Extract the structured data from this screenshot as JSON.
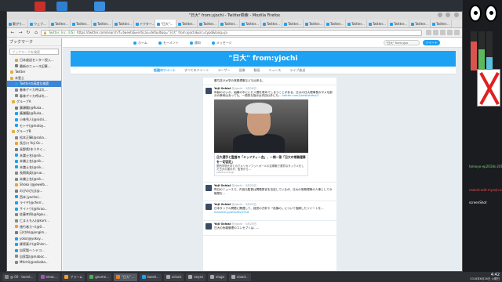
{
  "window_title": "\"日大\" from:yjochi - Twitter検索 - Mozilla Firefox",
  "tabs": [
    {
      "label": "繋がり..."
    },
    {
      "label": "ウェブ..."
    },
    {
      "label": "Twitter..."
    },
    {
      "label": "Twitter..."
    },
    {
      "label": "Twitter..."
    },
    {
      "label": "Twitter..."
    },
    {
      "label": "ドクター..."
    },
    {
      "label": "\"日大\"..."
    },
    {
      "label": "Twitter..."
    },
    {
      "label": "Twitter..."
    },
    {
      "label": "Twitter..."
    },
    {
      "label": "Twitter..."
    },
    {
      "label": "Twitter..."
    },
    {
      "label": "Twitter..."
    },
    {
      "label": "Twitter..."
    },
    {
      "label": "Twitter..."
    },
    {
      "label": "Twitter..."
    },
    {
      "label": "Twitter..."
    },
    {
      "label": "Twitter..."
    },
    {
      "label": "Twitter..."
    },
    {
      "label": "Twitter..."
    }
  ],
  "url": {
    "site": "Twitter, Inc. (US)",
    "path": "https://twitter.com/search?f=tweets&vertical=default&q=\"日大\" from:yjochi&src=typd&lang=ja"
  },
  "sidebar": {
    "title": "ブックマーク",
    "search_placeholder": "ブックマークを検索",
    "items": [
      {
        "label": "日本放送センター投入..."
      },
      {
        "label": "最新のニュース記事..."
      },
      {
        "label": "Twitter"
      },
      {
        "label": "未登士"
      },
      {
        "label": "Twitterの高度な検索"
      },
      {
        "label": "春林ゲイカ呼ばれ..."
      },
      {
        "label": "春林ゲイカ呼ばれ..."
      },
      {
        "label": "グループA"
      },
      {
        "label": "廣瀬龍(@Ruka..."
      },
      {
        "label": "廣瀬龍(@Ruka..."
      },
      {
        "label": "小林秀人(@nishi..."
      },
      {
        "label": "モトヤ(@motoy..."
      },
      {
        "label": "グループB"
      },
      {
        "label": "松本正輝(@saka..."
      },
      {
        "label": "長谷川 Yoji Oc..."
      },
      {
        "label": "長野県(ゆうやく..."
      },
      {
        "label": "未識士名(@nik..."
      },
      {
        "label": "未識士名(@nik..."
      },
      {
        "label": "未識士名(@nik..."
      },
      {
        "label": "長期高英(@ruo..."
      },
      {
        "label": "未識士名(@nik..."
      },
      {
        "label": "Shoko (@jewelb..."
      },
      {
        "label": "のびのび山(@..."
      },
      {
        "label": "西本 Jyocho(..."
      },
      {
        "label": "ライヤ(@cherr..."
      },
      {
        "label": "サイトウ(@hirao..."
      },
      {
        "label": "佐藤幸四(@Agou..."
      },
      {
        "label": "仁まえもん(@kum..."
      },
      {
        "label": "旅行者カイ(@0..."
      },
      {
        "label": "日付市(@jongim..."
      },
      {
        "label": "yoko(@yokoy..."
      },
      {
        "label": "柳原真介(@Shinn..."
      },
      {
        "label": "自家製ヘンテコ..."
      },
      {
        "label": "自家製(@maboc..."
      },
      {
        "label": "Mtichi(@seikoba..."
      }
    ]
  },
  "twitter_nav": {
    "home": "ホーム",
    "moments": "モーメント",
    "notifications": "通知",
    "messages": "メッセージ",
    "search_value": "\"日大\" from:yjoc",
    "tweet_button": "ツイート"
  },
  "banner_title": "\"日大\" from:yjochi",
  "subnav": [
    "話題のツイート",
    "すべてのツイート",
    "ユーザー",
    "画像",
    "動画",
    "ニュース",
    "ライブ放送"
  ],
  "tweets": [
    {
      "header": "",
      "handle": "",
      "text": "勝ち抜け大学の常務理事なども出来る。"
    },
    {
      "header": "Yoji Ochiai",
      "handle": "@yjochi · 5月26日",
      "text": "年齢のせいか、組織の中にいた人間を褒めてしまうことがある。日大の日大理事長のダメな部分の事例はあっても、一般的な指示は内田以外にも…",
      "link": "twitter.com/i/web/status/1",
      "has_photo": true,
      "card_title": "日大選手と監督の「ミッドティー会」、一問一答「日大の常務理事を一切否定」",
      "card_desc": "関西学院大学とのアメリカンフットボールの定期戦で悪質なタックルをした日大の選手が、監督から…",
      "card_url": "yomiuri.co.jp"
    },
    {
      "header": "Yoji Ochiai",
      "handle": "@yjochi · 5月25日",
      "text": "昨日のニュースで、内田元監督は問題発言を否定しているが、日大の常務理事の人事としての権限を…",
      "link": ""
    },
    {
      "header": "Yoji Ochiai",
      "handle": "@yjochi · 5月25日",
      "text": "日本タックル問題に関連して、経営の方針や「危機の」について指摘したツイートを…",
      "link": "mainichi.jp/articles/2018"
    },
    {
      "header": "Yoji Ochiai",
      "handle": "@yjochi · 5月25日",
      "text": "日大の危機管理のコンセプトは……",
      "link": ""
    }
  ],
  "right_rail": {
    "labels": [
      {
        "text": "tomoyo-ep2018s-201801"
      },
      {
        "text": "rewest-add-mysql-ucsq.m"
      },
      {
        "text": "screenShot"
      }
    ]
  },
  "gauges": [
    {
      "color": "#d9534f",
      "level": 0.75
    },
    {
      "color": "#5cb85c",
      "level": 0.55
    },
    {
      "color": "#5bc0de",
      "level": 0.35
    }
  ],
  "taskbar": {
    "items": [
      {
        "label": "@ 00 - tweet..."
      },
      {
        "label": "emac..."
      },
      {
        "label": "アラーム"
      },
      {
        "label": "gnome..."
      },
      {
        "label": "\"日大\" ..."
      },
      {
        "label": "tweet..."
      },
      {
        "label": "xclock"
      },
      {
        "label": "xeyes"
      },
      {
        "label": "xlogo"
      },
      {
        "label": "xload..."
      }
    ],
    "time": "4:42",
    "date": "2018年6月26日 火曜日"
  }
}
